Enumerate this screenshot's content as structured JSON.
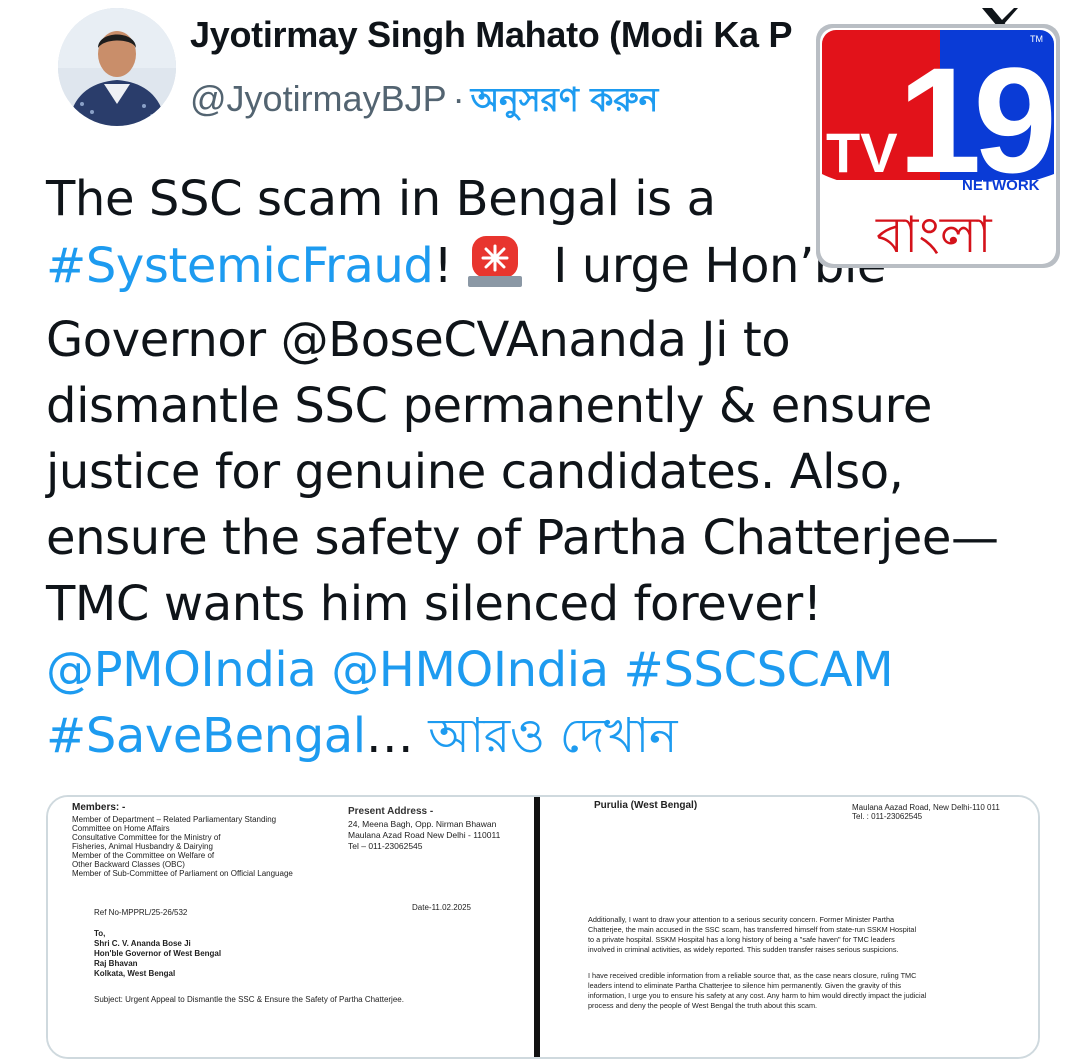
{
  "header": {
    "display_name": "Jyotirmay Singh Mahato (Modi Ka P",
    "handle": "@JyotirmayBJP",
    "separator": "·",
    "follow_label": "অনুসরণ করুন"
  },
  "tweet": {
    "lines": [
      [
        "The SSC scam in Bengal is a"
      ],
      [
        "#SystemicFraud",
        "!",
        " I urge Hon’ble"
      ],
      [
        "Governor @BoseCVAnanda Ji to"
      ],
      [
        "dismantle SSC permanently & ensure"
      ],
      [
        "justice for genuine candidates. Also,"
      ],
      [
        "ensure the safety of Partha Chatterjee—"
      ],
      [
        "TMC wants him silenced forever!"
      ],
      [
        "@PMOIndia @HMOIndia #SSCSCAM"
      ],
      [
        "#SaveBengal",
        "… ",
        "আরও দেখান"
      ]
    ]
  },
  "media_left": {
    "members_title": "Members: -",
    "members_lines": [
      "Member of Department – Related Parliamentary Standing",
      "Committee on Home Affairs",
      "Consultative Committee for the Ministry of",
      "Fisheries, Animal Husbandry & Dairying",
      "Member of the Committee on Welfare of",
      "Other Backward Classes (OBC)",
      "Member of Sub-Committee of Parliament on Official Language"
    ],
    "address_title": "Present Address -",
    "address_lines": [
      "24, Meena Bagh, Opp. Nirman Bhawan",
      "Maulana Azad Road New Delhi - 110011",
      "Tel – 011-23062545"
    ],
    "ref": "Ref No-MPPRL/25-26/532",
    "date": "Date-11.02.2025",
    "to_lines": [
      "To,",
      "Shri C. V. Ananda Bose Ji",
      "Hon'ble Governor of West Bengal",
      "Raj Bhavan",
      "Kolkata, West Bengal"
    ],
    "subject": "Subject: Urgent Appeal to Dismantle the SSC & Ensure the Safety of Partha Chatterjee."
  },
  "media_right": {
    "top_left": "Purulia (West Bengal)",
    "top_right": [
      "Maulana Aazad Road, New Delhi-110 011",
      "Tel. : 011-23062545"
    ],
    "paragraph1": [
      "Additionally, I want to draw your attention to a serious security concern. Former Minister Partha",
      "Chatterjee, the main accused in the SSC scam, has transferred himself from state-run SSKM Hospital",
      "to a private hospital. SSKM Hospital has a long history of being a \"safe haven\" for TMC leaders",
      "involved in criminal activities, as widely reported. This sudden transfer raises serious suspicions."
    ],
    "paragraph2": [
      "I have received credible information from a reliable source that, as the case nears closure, ruling TMC",
      "leaders intend to eliminate Partha Chatterjee to silence him permanently. Given the gravity of this",
      "information, I urge you to ensure his safety at any cost. Any harm to him would directly impact the judicial",
      "process and deny the people of West Bengal the truth about this scam."
    ]
  },
  "logo": {
    "brand": "TV",
    "number": "19",
    "tm": "TM",
    "network": "NETWORK",
    "language": "বাংলা"
  },
  "colors": {
    "link_blue": "#1d9bf0",
    "logo_red": "#e2121a",
    "logo_blue": "#0a3bd6"
  }
}
